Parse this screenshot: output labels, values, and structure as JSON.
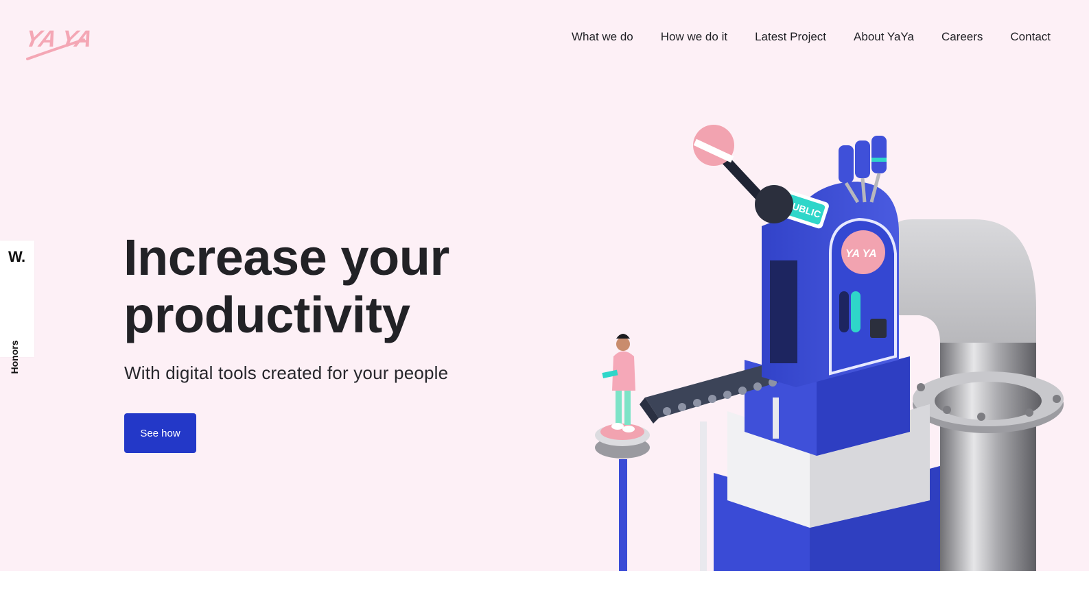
{
  "brand": {
    "logo_text": "YA YA",
    "logo_color": "#f4a7b5"
  },
  "nav": {
    "items": [
      {
        "label": "What we do"
      },
      {
        "label": "How we do it"
      },
      {
        "label": "Latest Project"
      },
      {
        "label": "About YaYa"
      },
      {
        "label": "Careers"
      },
      {
        "label": "Contact"
      }
    ]
  },
  "honors": {
    "badge": "W.",
    "label": "Honors"
  },
  "hero": {
    "headline_line1": "Increase your",
    "headline_line2": "productivity",
    "subline": "With digital tools created for your people",
    "cta_label": "See how"
  },
  "illustration": {
    "sign_text": "PUBLIC",
    "badge_text": "YA YA"
  },
  "colors": {
    "background": "#fdf0f6",
    "accent": "#2338c8",
    "pink": "#f4a7b5",
    "teal": "#2fd6c9"
  }
}
